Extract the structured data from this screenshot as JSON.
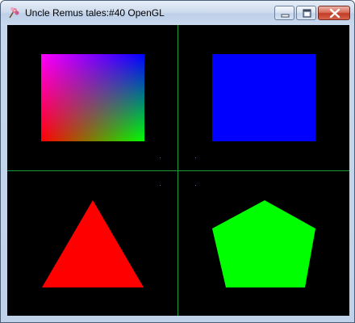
{
  "window": {
    "title": "Uncle Remus tales:#40 OpenGL",
    "app_icon": "flower-app-icon",
    "controls": {
      "minimize_icon": "minimize-icon",
      "maximize_icon": "maximize-icon",
      "close_icon": "close-icon"
    }
  },
  "viewport": {
    "background": "#000000",
    "divider_color": "#1f9a3a",
    "quadrants": [
      {
        "position": "top-left",
        "shape": "rectangle",
        "fill": "gradient",
        "gradient_colors": [
          "#ff00ff",
          "#0000ff",
          "#ff0000",
          "#00ff00"
        ]
      },
      {
        "position": "top-right",
        "shape": "rectangle",
        "fill": "#0000ff"
      },
      {
        "position": "bottom-left",
        "shape": "triangle",
        "fill": "#ff0000"
      },
      {
        "position": "bottom-right",
        "shape": "pentagon",
        "fill": "#00ff00"
      }
    ]
  }
}
